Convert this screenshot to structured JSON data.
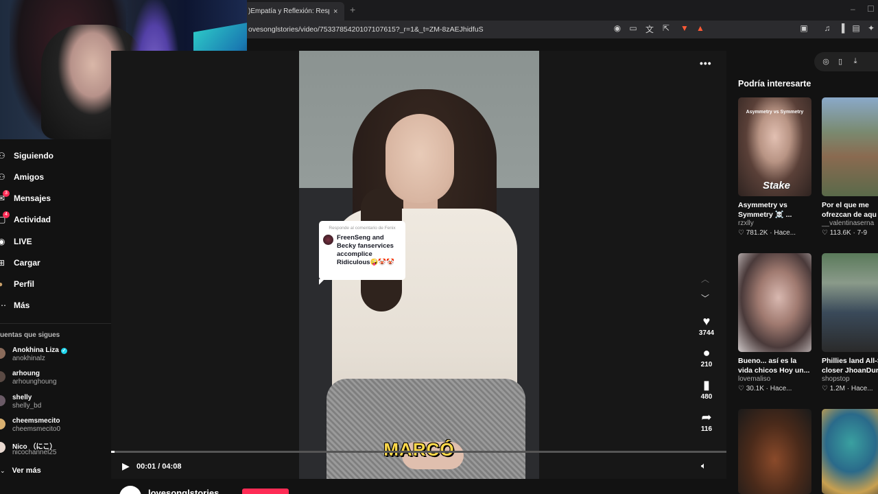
{
  "browser": {
    "tab_title": ")Empatía y Reflexión: Respuesta",
    "tab_close": "×",
    "new_tab": "+",
    "minimize": "–",
    "maximize": "☐",
    "url": "ovesonglstories/video/7533785420107107615?_r=1&_t=ZM-8zAEJhidfuS"
  },
  "sidebar": {
    "items": [
      {
        "label": "Siguiendo",
        "icon": "following-icon"
      },
      {
        "label": "Amigos",
        "icon": "friends-icon"
      },
      {
        "label": "Mensajes",
        "icon": "messages-icon",
        "badge": "3"
      },
      {
        "label": "Actividad",
        "icon": "activity-icon",
        "badge": "4"
      },
      {
        "label": "LIVE",
        "icon": "live-icon"
      },
      {
        "label": "Cargar",
        "icon": "upload-icon"
      },
      {
        "label": "Perfil",
        "icon": "profile-icon"
      },
      {
        "label": "Más",
        "icon": "more-icon"
      }
    ],
    "following_title": "uentas que sigues",
    "accounts": [
      {
        "name": "Anokhina Liza",
        "handle": "anokhinalz",
        "verified": true,
        "verified_mark": "✓"
      },
      {
        "name": "arhoung",
        "handle": "arhounghoung"
      },
      {
        "name": "shelly",
        "handle": "shelly_bd"
      },
      {
        "name": "cheemsmecito",
        "handle": "cheemsmecito0"
      },
      {
        "name": "Nico （にこ）",
        "handle": "nicochannel25"
      }
    ],
    "see_more": "Ver más"
  },
  "video": {
    "subtitle": "MARCÓ",
    "reply_header": "Responde al comentario de Fenix",
    "reply_text": "FreenSeng and Becky fanservices accomplice Ridiculous🤪🤡🤡",
    "likes": "3744",
    "comments": "210",
    "saves": "480",
    "shares": "116",
    "time": "00:01 / 04:08",
    "progress_fraction": 0.004,
    "author": "lovesonglstories"
  },
  "right_panel": {
    "title": "Podría interesarte",
    "cards": [
      {
        "title": "Asymmetry vs",
        "title2": "Symmetry ☠️ ...",
        "author": "rzxlly",
        "likes": "781.2K",
        "time": "Hace...",
        "overlay": "Asymmetry vs Symmetry",
        "brand": "Stake"
      },
      {
        "title": "Por el que me",
        "title2": "ofrezcan de aqu",
        "author": "__valentinaserna",
        "likes": "113.6K",
        "time": "7-9"
      },
      {
        "title": "Bueno... así es la",
        "title2": "vida chicos Hoy un...",
        "author": "lovemaliso",
        "likes": "30.1K",
        "time": "Hace..."
      },
      {
        "title": "Phillies land All-S",
        "title2": "closer JhoanDur",
        "author": "shopstop",
        "likes": "1.2M",
        "time": "Hace..."
      }
    ]
  },
  "colors": {
    "accent": "#fe2c55",
    "background": "#121212",
    "subtitle": "#ffd94a"
  }
}
